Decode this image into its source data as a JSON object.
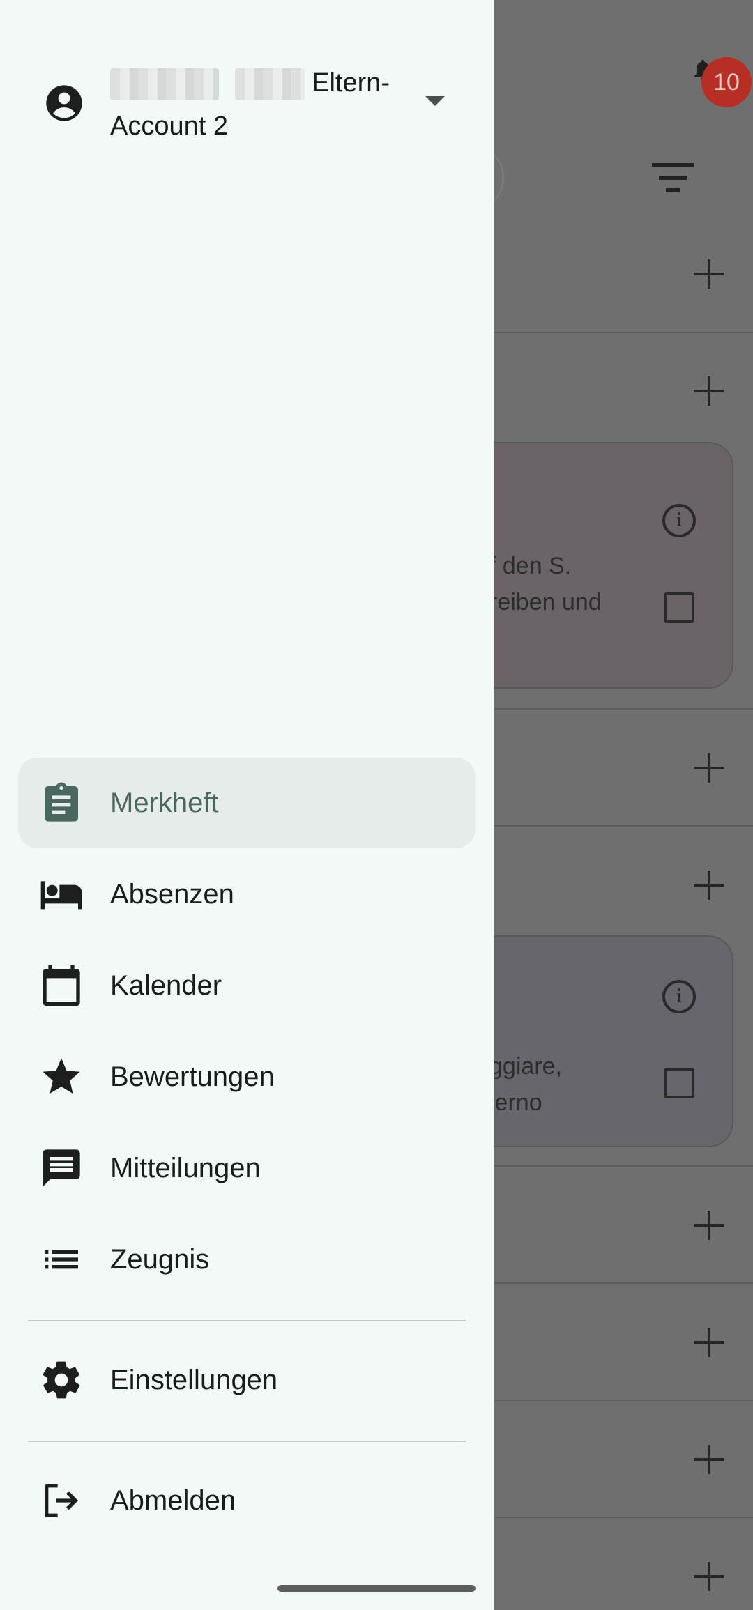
{
  "background": {
    "notification_count": "10",
    "card1_lines": [
      "f den S.",
      "reiben und"
    ],
    "card2_lines": [
      "ggiare,",
      "lerno"
    ]
  },
  "drawer": {
    "account": {
      "name_suffix": "Eltern-",
      "name_line2": "Account 2"
    },
    "nav_items": [
      {
        "label": "Merkheft",
        "icon": "clipboard-icon"
      },
      {
        "label": "Absenzen",
        "icon": "bed-icon"
      },
      {
        "label": "Kalender",
        "icon": "calendar-icon"
      },
      {
        "label": "Bewertungen",
        "icon": "star-icon"
      },
      {
        "label": "Mitteilungen",
        "icon": "message-icon"
      },
      {
        "label": "Zeugnis",
        "icon": "list-icon"
      }
    ],
    "settings": {
      "label": "Einstellungen",
      "icon": "gear-icon"
    },
    "logout": {
      "label": "Abmelden",
      "icon": "logout-icon"
    }
  },
  "colors": {
    "drawer_bg": "#f2f9f7",
    "active_bg": "#e6ecea",
    "active_text": "#4a6660",
    "badge": "#b72e25"
  }
}
